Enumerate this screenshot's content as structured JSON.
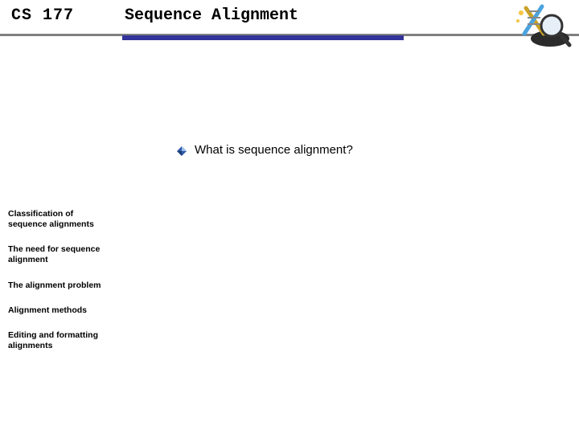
{
  "header": {
    "course": "CS 177",
    "title": "Sequence Alignment"
  },
  "content": {
    "bullet": "What is sequence alignment?"
  },
  "sidebar": {
    "items": [
      {
        "label": "Classification of sequence alignments"
      },
      {
        "label": "The need for sequence alignment"
      },
      {
        "label": "The alignment problem"
      },
      {
        "label": "Alignment methods"
      },
      {
        "label": "Editing and formatting alignments"
      }
    ]
  },
  "icons": {
    "corner": "dna-magnifier-graphic",
    "bullet": "diamond-bullet-icon"
  },
  "colors": {
    "ruleBlue": "#333399",
    "ruleGray": "#808080",
    "bulletFillA": "#9fbfe8",
    "bulletFillB": "#2e5aa8"
  }
}
